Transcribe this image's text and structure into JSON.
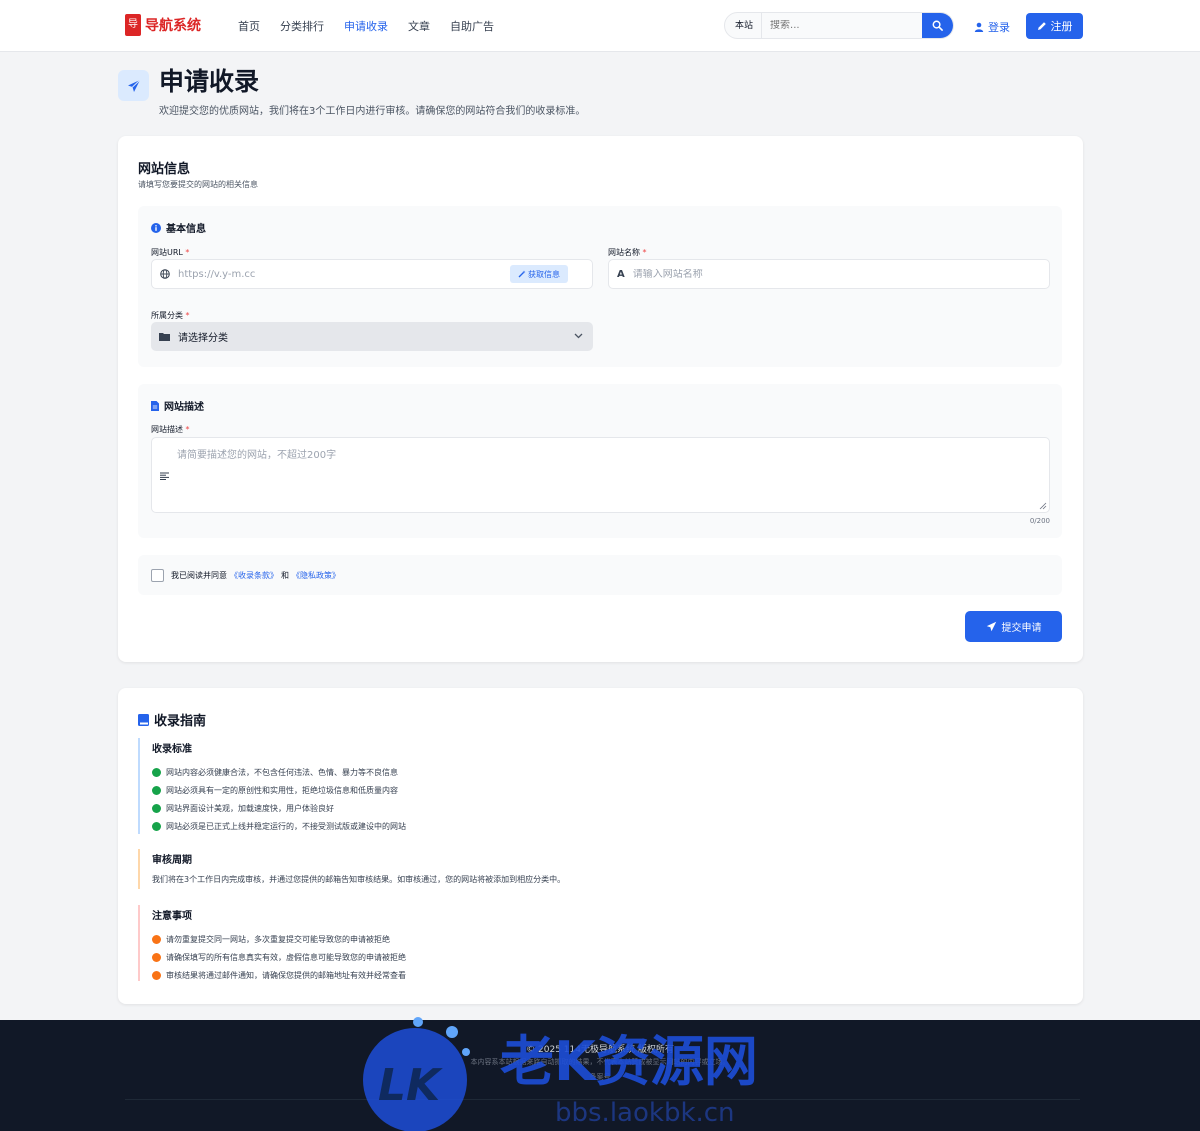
{
  "header": {
    "logo_text": "导航系统",
    "nav": [
      "首页",
      "分类排行",
      "申请收录",
      "文章",
      "自助广告"
    ],
    "search_scope": "本站",
    "search_placeholder": "搜索...",
    "login_label": "登录",
    "register_label": "注册"
  },
  "page": {
    "title": "申请收录",
    "subtitle": "欢迎提交您的优质网站，我们将在3个工作日内进行审核。请确保您的网站符合我们的收录标准。"
  },
  "form": {
    "title": "网站信息",
    "subtitle": "请填写您要提交的网站的相关信息",
    "basic": {
      "heading": "基本信息",
      "url_label": "网站URL",
      "url_placeholder": "https://v.y-m.cc",
      "fetch_label": "获取信息",
      "name_label": "网站名称",
      "name_placeholder": "请输入网站名称",
      "category_label": "所属分类",
      "category_value": "请选择分类"
    },
    "desc": {
      "heading": "网站描述",
      "label": "网站描述",
      "placeholder": "请简要描述您的网站，不超过200字",
      "counter": "0/200"
    },
    "agree": {
      "prefix": "我已阅读并同意",
      "terms": "《收录条款》",
      "and": "和",
      "privacy": "《隐私政策》"
    },
    "submit_label": "提交申请",
    "required_mark": "*"
  },
  "guide": {
    "title": "收录指南",
    "standards": {
      "heading": "收录标准",
      "items": [
        "网站内容必须健康合法，不包含任何违法、色情、暴力等不良信息",
        "网站必须具有一定的原创性和实用性，拒绝垃圾信息和低质量内容",
        "网站界面设计美观，加载速度快，用户体验良好",
        "网站必须是已正式上线并稳定运行的，不接受测试版或建设中的网站"
      ]
    },
    "cycle": {
      "heading": "审核周期",
      "text": "我们将在3个工作日内完成审核，并通过您提供的邮箱告知审核结果。如审核通过，您的网站将被添加到相应分类中。"
    },
    "notes": {
      "heading": "注意事项",
      "items": [
        "请勿重复提交同一网站，多次重复提交可能导致您的申请被拒绝",
        "请确保填写的所有信息真实有效，虚假信息可能导致您的申请被拒绝",
        "审核结果将通过邮件通知，请确保您提供的邮箱地址有效并经常查看"
      ]
    }
  },
  "footer": {
    "copyright": "© 2025 114无极导航系统 版权所有",
    "disclaimer": "本内容系本站根据来路自动抓取的结果，不代表本站赞成被显示网站的内容或立场。",
    "icp": "备案号"
  },
  "watermark": {
    "logo_letters": "LK",
    "text": "老K资源网",
    "url": "bbs.laokbk.cn"
  },
  "colors": {
    "primary": "#2563eb",
    "brand_red": "#dc2626",
    "success": "#16a34a",
    "warning": "#f97316",
    "footer_bg": "#111827"
  }
}
